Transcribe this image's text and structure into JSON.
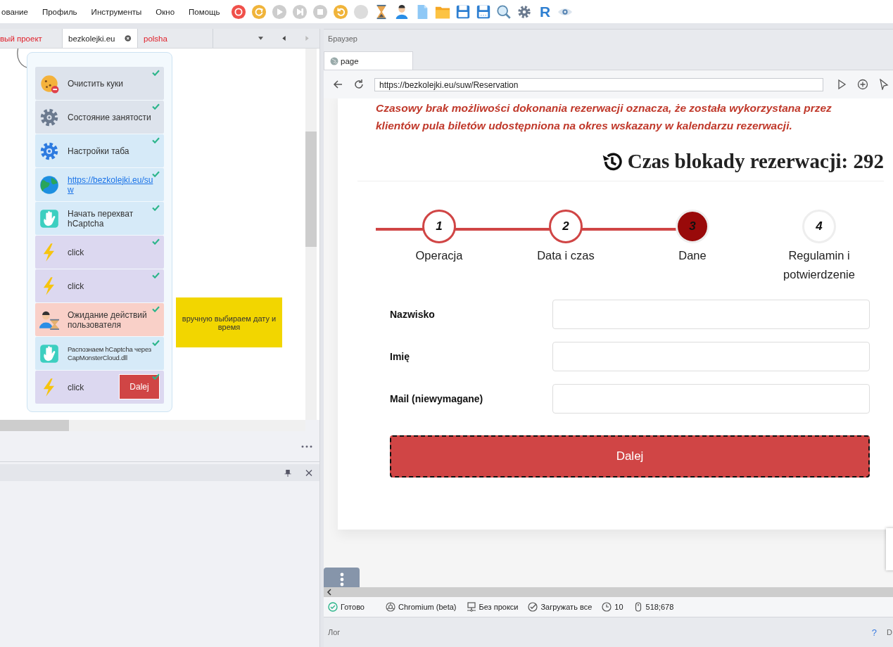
{
  "menu": [
    {
      "label": "ование"
    },
    {
      "label": "Профиль"
    },
    {
      "label": "Инструменты"
    },
    {
      "label": "Окно"
    },
    {
      "label": "Помощь"
    }
  ],
  "toolbar": [
    {
      "kind": "record",
      "disabled": false
    },
    {
      "kind": "refresh",
      "disabled": false
    },
    {
      "kind": "play",
      "disabled": true
    },
    {
      "kind": "step",
      "disabled": true
    },
    {
      "kind": "stop",
      "disabled": true
    },
    {
      "kind": "undo",
      "disabled": false
    },
    {
      "kind": "blank",
      "disabled": true
    },
    {
      "kind": "hourglass",
      "disabled": false
    },
    {
      "kind": "person",
      "disabled": false
    },
    {
      "kind": "file",
      "disabled": false
    },
    {
      "kind": "folder",
      "disabled": false
    },
    {
      "kind": "save",
      "disabled": false
    },
    {
      "kind": "saveas",
      "disabled": false
    },
    {
      "kind": "search",
      "disabled": false
    },
    {
      "kind": "gear",
      "disabled": false
    },
    {
      "kind": "letter",
      "label": "R",
      "disabled": false
    },
    {
      "kind": "eye",
      "disabled": false
    }
  ],
  "project_tabs": [
    {
      "label": "вый проект",
      "selected": false,
      "modified": true
    },
    {
      "label": "bezkolejki.eu",
      "selected": true,
      "modified": false
    },
    {
      "label": "polsha",
      "selected": false,
      "modified": true
    }
  ],
  "actions": [
    {
      "kind": "cookie",
      "label": "Очистить куки",
      "color": "#dde3ec",
      "done": true
    },
    {
      "kind": "busy",
      "label": "Состояние занятости",
      "color": "#dde3ec",
      "done": true
    },
    {
      "kind": "tab",
      "label": "Настройки таба",
      "color": "#d6eaf8",
      "done": true
    },
    {
      "kind": "navigate",
      "label": "https://bezkolejki.eu/suw",
      "color": "#d6eaf8",
      "done": true,
      "link": true
    },
    {
      "kind": "captcha",
      "label": "Начать перехват hCaptcha",
      "color": "#d6eaf8",
      "done": true
    },
    {
      "kind": "click",
      "label": "click",
      "color": "#dcd8f0",
      "done": true
    },
    {
      "kind": "click",
      "label": "click",
      "color": "#dcd8f0",
      "done": true
    },
    {
      "kind": "wait",
      "label": "Ожидание действий пользователя",
      "color": "#f9d0c8",
      "done": true
    },
    {
      "kind": "captcha",
      "label": "Распознаем hCaptcha через CapMonsterCloud.dll",
      "color": "#d6eaf8",
      "done": true,
      "small": true
    },
    {
      "kind": "click",
      "label": "click",
      "color": "#dcd8f0",
      "done": true,
      "preview": "Dalej"
    }
  ],
  "note": {
    "text": "вручную выбираем дату и время"
  },
  "browser": {
    "title": "Браузер",
    "tab": "page",
    "url": "https://bezkolejki.eu/suw/Reservation",
    "notice": "Czasowy brak możliwości dokonania rezerwacji oznacza, że została wykorzystana przez klientów pula biletów udostępniona na okres wskazany w kalendarzu rezerwacji.",
    "timer": "Czas blokady rezerwacji: 292",
    "steps": [
      {
        "number": "1",
        "label": "Operacja",
        "completed": true,
        "selected": false
      },
      {
        "number": "2",
        "label": "Data i czas",
        "completed": true,
        "selected": false
      },
      {
        "number": "3",
        "label": "Dane",
        "completed": false,
        "selected": true
      },
      {
        "number": "4",
        "label": "Regulamin i potwierdzenie",
        "completed": false,
        "selected": false
      }
    ],
    "fields": [
      {
        "label": "Nazwisko"
      },
      {
        "label": "Imię"
      },
      {
        "label": "Mail (niewymagane)"
      }
    ],
    "submit": "Dalej"
  },
  "status_bar": [
    {
      "kind": "ok",
      "text": "Готово"
    },
    {
      "kind": "engine",
      "text": "Chromium (beta)"
    },
    {
      "kind": "proxy",
      "text": "Без прокси"
    },
    {
      "kind": "load",
      "text": "Загружать все"
    },
    {
      "kind": "clock",
      "text": "10"
    },
    {
      "kind": "mouse",
      "text": "518;678"
    }
  ],
  "log": {
    "title": "Лог",
    "help": "?",
    "cut": "D"
  }
}
